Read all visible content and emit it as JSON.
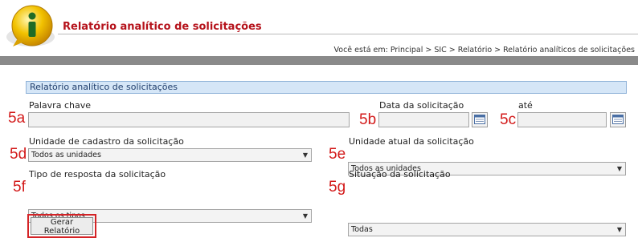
{
  "header": {
    "title": "Relatório analítico de solicitações",
    "logo_letter": "i"
  },
  "breadcrumb": {
    "prefix": "Você está em:",
    "items": [
      "Principal",
      "SIC",
      "Relatório",
      "Relatório analíticos de solicitações"
    ],
    "separator": ">"
  },
  "form": {
    "section_title": "Relatório analítico de solicitações",
    "keyword": {
      "marker": "5a",
      "label": "Palavra chave",
      "value": ""
    },
    "date_from": {
      "marker": "5b",
      "label": "Data da solicitação",
      "value": ""
    },
    "date_to": {
      "marker": "5c",
      "label": "até",
      "value": ""
    },
    "registration_unit": {
      "marker": "5d",
      "label": "Unidade de cadastro da solicitação",
      "selected": "Todos as unidades"
    },
    "current_unit": {
      "marker": "5e",
      "label": "Unidade atual da solicitação",
      "selected": "Todos as unidades"
    },
    "response_type": {
      "marker": "5f",
      "label": "Tipo de resposta da solicitação",
      "selected": "Todos os tipos"
    },
    "status": {
      "marker": "5g",
      "label": "Situação da solicitação",
      "selected": "Todas"
    },
    "submit_label": "Gerar Relatório"
  },
  "colors": {
    "title": "#b5121b",
    "section_bg": "#d5e6f7",
    "section_border": "#8fb2d8",
    "marker": "#d31a1a",
    "highlight_border": "#d42326",
    "band": "#8a8a8a"
  },
  "icons": {
    "logo": "info-icon",
    "calendar": "calendar-icon",
    "dropdown": "chevron-down-icon"
  }
}
